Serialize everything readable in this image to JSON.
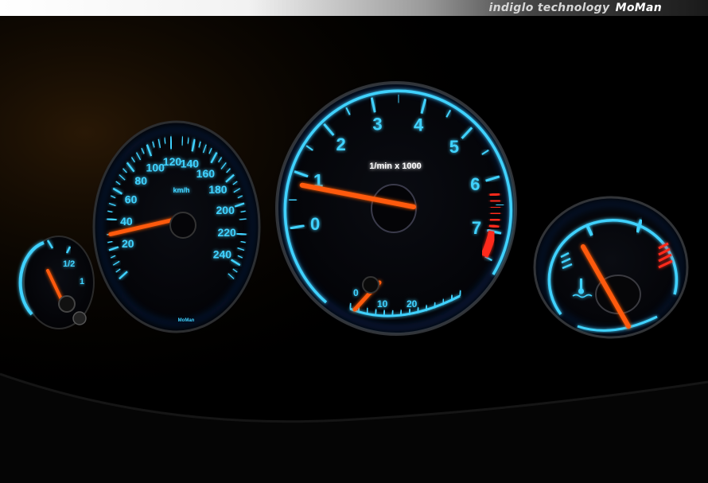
{
  "banner": {
    "brand_text": "indiglo technology",
    "brand_mark": "MoMan"
  },
  "colors": {
    "glow": "#3fd2ff",
    "glow_deep": "#1a6cff",
    "needle": "#ff5a10",
    "redline": "#ff2a1a"
  },
  "speedometer": {
    "unit": "km/h",
    "logo": "MoMan",
    "labels": [
      "20",
      "40",
      "60",
      "80",
      "100",
      "120",
      "140",
      "160",
      "180",
      "200",
      "220",
      "240"
    ],
    "reading_kmh": 30
  },
  "tachometer": {
    "unit": "1/min x 1000",
    "labels": [
      "0",
      "1",
      "2",
      "3",
      "4",
      "5",
      "6",
      "7"
    ],
    "reading_rpm_x1000": 0.8,
    "economy": {
      "labels": [
        "0",
        "10",
        "20"
      ]
    }
  },
  "fuel_gauge": {
    "labels": [
      "1/2",
      "1"
    ]
  },
  "temp_gauge": {
    "icon": "coolant-temperature-icon"
  }
}
